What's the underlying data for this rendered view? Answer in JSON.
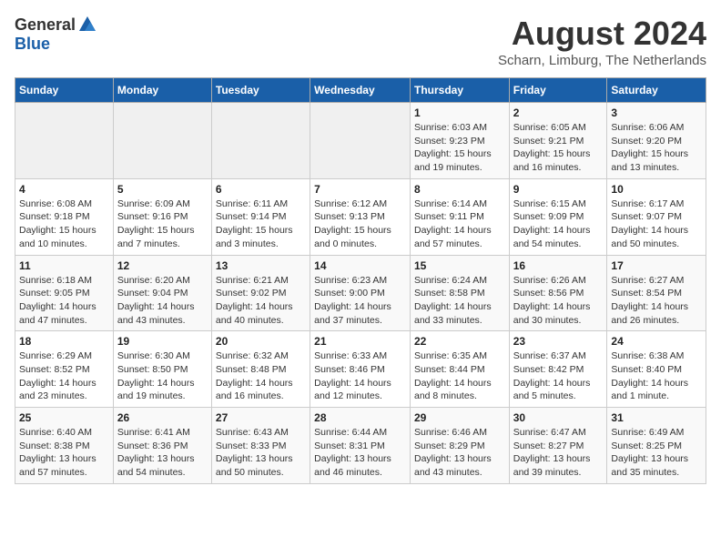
{
  "logo": {
    "general": "General",
    "blue": "Blue"
  },
  "title": "August 2024",
  "location": "Scharn, Limburg, The Netherlands",
  "weekdays": [
    "Sunday",
    "Monday",
    "Tuesday",
    "Wednesday",
    "Thursday",
    "Friday",
    "Saturday"
  ],
  "weeks": [
    [
      {
        "day": "",
        "info": ""
      },
      {
        "day": "",
        "info": ""
      },
      {
        "day": "",
        "info": ""
      },
      {
        "day": "",
        "info": ""
      },
      {
        "day": "1",
        "info": "Sunrise: 6:03 AM\nSunset: 9:23 PM\nDaylight: 15 hours\nand 19 minutes."
      },
      {
        "day": "2",
        "info": "Sunrise: 6:05 AM\nSunset: 9:21 PM\nDaylight: 15 hours\nand 16 minutes."
      },
      {
        "day": "3",
        "info": "Sunrise: 6:06 AM\nSunset: 9:20 PM\nDaylight: 15 hours\nand 13 minutes."
      }
    ],
    [
      {
        "day": "4",
        "info": "Sunrise: 6:08 AM\nSunset: 9:18 PM\nDaylight: 15 hours\nand 10 minutes."
      },
      {
        "day": "5",
        "info": "Sunrise: 6:09 AM\nSunset: 9:16 PM\nDaylight: 15 hours\nand 7 minutes."
      },
      {
        "day": "6",
        "info": "Sunrise: 6:11 AM\nSunset: 9:14 PM\nDaylight: 15 hours\nand 3 minutes."
      },
      {
        "day": "7",
        "info": "Sunrise: 6:12 AM\nSunset: 9:13 PM\nDaylight: 15 hours\nand 0 minutes."
      },
      {
        "day": "8",
        "info": "Sunrise: 6:14 AM\nSunset: 9:11 PM\nDaylight: 14 hours\nand 57 minutes."
      },
      {
        "day": "9",
        "info": "Sunrise: 6:15 AM\nSunset: 9:09 PM\nDaylight: 14 hours\nand 54 minutes."
      },
      {
        "day": "10",
        "info": "Sunrise: 6:17 AM\nSunset: 9:07 PM\nDaylight: 14 hours\nand 50 minutes."
      }
    ],
    [
      {
        "day": "11",
        "info": "Sunrise: 6:18 AM\nSunset: 9:05 PM\nDaylight: 14 hours\nand 47 minutes."
      },
      {
        "day": "12",
        "info": "Sunrise: 6:20 AM\nSunset: 9:04 PM\nDaylight: 14 hours\nand 43 minutes."
      },
      {
        "day": "13",
        "info": "Sunrise: 6:21 AM\nSunset: 9:02 PM\nDaylight: 14 hours\nand 40 minutes."
      },
      {
        "day": "14",
        "info": "Sunrise: 6:23 AM\nSunset: 9:00 PM\nDaylight: 14 hours\nand 37 minutes."
      },
      {
        "day": "15",
        "info": "Sunrise: 6:24 AM\nSunset: 8:58 PM\nDaylight: 14 hours\nand 33 minutes."
      },
      {
        "day": "16",
        "info": "Sunrise: 6:26 AM\nSunset: 8:56 PM\nDaylight: 14 hours\nand 30 minutes."
      },
      {
        "day": "17",
        "info": "Sunrise: 6:27 AM\nSunset: 8:54 PM\nDaylight: 14 hours\nand 26 minutes."
      }
    ],
    [
      {
        "day": "18",
        "info": "Sunrise: 6:29 AM\nSunset: 8:52 PM\nDaylight: 14 hours\nand 23 minutes."
      },
      {
        "day": "19",
        "info": "Sunrise: 6:30 AM\nSunset: 8:50 PM\nDaylight: 14 hours\nand 19 minutes."
      },
      {
        "day": "20",
        "info": "Sunrise: 6:32 AM\nSunset: 8:48 PM\nDaylight: 14 hours\nand 16 minutes."
      },
      {
        "day": "21",
        "info": "Sunrise: 6:33 AM\nSunset: 8:46 PM\nDaylight: 14 hours\nand 12 minutes."
      },
      {
        "day": "22",
        "info": "Sunrise: 6:35 AM\nSunset: 8:44 PM\nDaylight: 14 hours\nand 8 minutes."
      },
      {
        "day": "23",
        "info": "Sunrise: 6:37 AM\nSunset: 8:42 PM\nDaylight: 14 hours\nand 5 minutes."
      },
      {
        "day": "24",
        "info": "Sunrise: 6:38 AM\nSunset: 8:40 PM\nDaylight: 14 hours\nand 1 minute."
      }
    ],
    [
      {
        "day": "25",
        "info": "Sunrise: 6:40 AM\nSunset: 8:38 PM\nDaylight: 13 hours\nand 57 minutes."
      },
      {
        "day": "26",
        "info": "Sunrise: 6:41 AM\nSunset: 8:36 PM\nDaylight: 13 hours\nand 54 minutes."
      },
      {
        "day": "27",
        "info": "Sunrise: 6:43 AM\nSunset: 8:33 PM\nDaylight: 13 hours\nand 50 minutes."
      },
      {
        "day": "28",
        "info": "Sunrise: 6:44 AM\nSunset: 8:31 PM\nDaylight: 13 hours\nand 46 minutes."
      },
      {
        "day": "29",
        "info": "Sunrise: 6:46 AM\nSunset: 8:29 PM\nDaylight: 13 hours\nand 43 minutes."
      },
      {
        "day": "30",
        "info": "Sunrise: 6:47 AM\nSunset: 8:27 PM\nDaylight: 13 hours\nand 39 minutes."
      },
      {
        "day": "31",
        "info": "Sunrise: 6:49 AM\nSunset: 8:25 PM\nDaylight: 13 hours\nand 35 minutes."
      }
    ]
  ]
}
